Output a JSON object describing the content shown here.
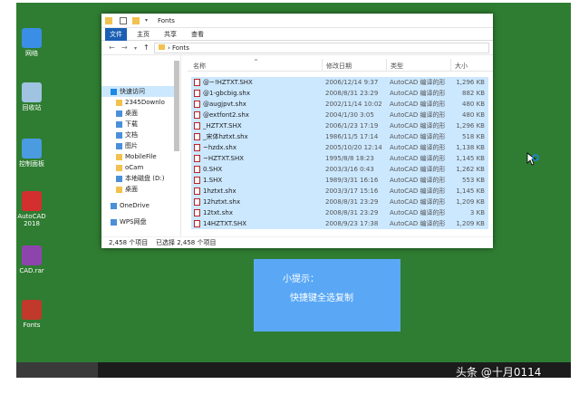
{
  "desktop": {
    "icons": [
      {
        "label": "网络",
        "icon": "network-icon",
        "color": "#3a8ee6"
      },
      {
        "label": "回收站",
        "icon": "recycle-bin-icon",
        "color": "#9fc3e0"
      },
      {
        "label": "控制面板",
        "icon": "control-panel-icon",
        "color": "#4a9be0"
      },
      {
        "label": "AutoCAD 2018",
        "icon": "autocad-icon",
        "color": "#d32f2f"
      },
      {
        "label": "CAD.rar",
        "icon": "archive-icon",
        "color": "#8e44ad"
      },
      {
        "label": "Fonts",
        "icon": "fonts-folder-icon",
        "color": "#c0392b"
      }
    ]
  },
  "explorer": {
    "title": "Fonts",
    "ribbon_tabs": [
      "文件",
      "主页",
      "共享",
      "查看"
    ],
    "address_path": "Fonts",
    "sidebar": [
      {
        "label": "快速访问",
        "icon": "star-icon",
        "selected": true
      },
      {
        "label": "2345Downlo",
        "icon": "folder-icon"
      },
      {
        "label": "桌面",
        "icon": "desktop-icon"
      },
      {
        "label": "下载",
        "icon": "download-icon"
      },
      {
        "label": "文档",
        "icon": "document-icon"
      },
      {
        "label": "图片",
        "icon": "picture-icon"
      },
      {
        "label": "MobileFile",
        "icon": "folder-icon"
      },
      {
        "label": "oCam",
        "icon": "folder-icon"
      },
      {
        "label": "本地磁盘 (D:)",
        "icon": "drive-icon"
      },
      {
        "label": "桌面",
        "icon": "folder-icon"
      },
      {
        "label": "OneDrive",
        "icon": "cloud-icon"
      },
      {
        "label": "WPS网盘",
        "icon": "wps-cloud-icon"
      }
    ],
    "columns": {
      "name": "名称",
      "date": "修改日期",
      "type": "类型",
      "size": "大小"
    },
    "files": [
      {
        "name": "@~!HZTXT.SHX",
        "date": "2006/12/14 9:37",
        "type": "AutoCAD 编译的形",
        "size": "1,296 KB"
      },
      {
        "name": "@1-gbcbig.shx",
        "date": "2008/8/31 23:29",
        "type": "AutoCAD 编译的形",
        "size": "882 KB"
      },
      {
        "name": "@augjpvt.shx",
        "date": "2002/11/14 10:02",
        "type": "AutoCAD 编译的形",
        "size": "480 KB"
      },
      {
        "name": "@extfont2.shx",
        "date": "2004/1/30 3:05",
        "type": "AutoCAD 编译的形",
        "size": "480 KB"
      },
      {
        "name": "_HZTXT.SHX",
        "date": "2006/1/23 17:19",
        "type": "AutoCAD 编译的形",
        "size": "1,296 KB"
      },
      {
        "name": "_宋体hztxt.shx",
        "date": "1986/11/5 17:14",
        "type": "AutoCAD 编译的形",
        "size": "518 KB"
      },
      {
        "name": "~hzdx.shx",
        "date": "2005/10/20 12:14",
        "type": "AutoCAD 编译的形",
        "size": "1,138 KB"
      },
      {
        "name": "~HZTXT.SHX",
        "date": "1995/8/8 18:23",
        "type": "AutoCAD 编译的形",
        "size": "1,145 KB"
      },
      {
        "name": "0.SHX",
        "date": "2003/3/16 0:43",
        "type": "AutoCAD 编译的形",
        "size": "1,262 KB"
      },
      {
        "name": "1.SHX",
        "date": "1989/3/31 16:16",
        "type": "AutoCAD 编译的形",
        "size": "553 KB"
      },
      {
        "name": "1hztxt.shx",
        "date": "2003/3/17 15:16",
        "type": "AutoCAD 编译的形",
        "size": "1,145 KB"
      },
      {
        "name": "12hztxt.shx",
        "date": "2008/8/31 23:29",
        "type": "AutoCAD 编译的形",
        "size": "1,209 KB"
      },
      {
        "name": "12txt.shx",
        "date": "2008/8/31 23:29",
        "type": "AutoCAD 编译的形",
        "size": "3 KB"
      },
      {
        "name": "14HZTXT.SHX",
        "date": "2008/9/23 17:38",
        "type": "AutoCAD 编译的形",
        "size": "1,209 KB"
      }
    ],
    "status_count": "2,458 个项目",
    "status_selected": "已选择 2,458 个项目"
  },
  "tip": {
    "title": "小提示：",
    "body": "快捷键全选复制"
  },
  "watermark": "头条 @十月0114"
}
